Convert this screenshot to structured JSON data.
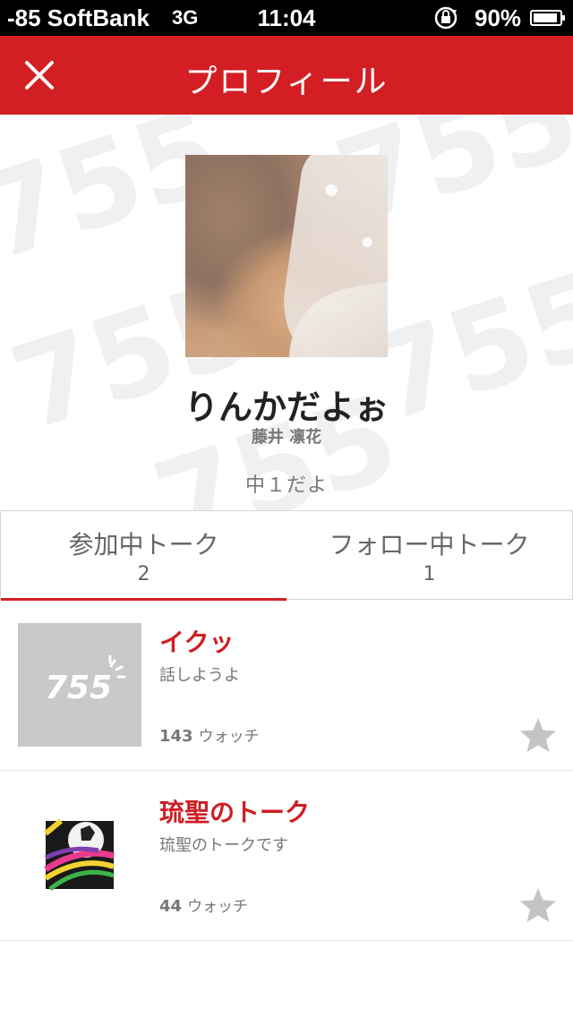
{
  "status_bar": {
    "carrier": "-85 SoftBank",
    "network": "3G",
    "time": "11:04",
    "battery": "90%"
  },
  "nav": {
    "title": "プロフィール",
    "close_icon": "close-icon"
  },
  "profile": {
    "display_name": "りんかだよぉ",
    "real_name": "藤井 凛花",
    "bio": "中１だよ",
    "watermark_text": "755"
  },
  "tabs": [
    {
      "label": "参加中トーク",
      "count": "2",
      "active": true
    },
    {
      "label": "フォロー中トーク",
      "count": "1",
      "active": false
    }
  ],
  "talks": [
    {
      "title": "イクッ",
      "description": "話しようよ",
      "watch_count": "143",
      "watch_label": "ウォッチ",
      "thumb_logo": "755"
    },
    {
      "title": "琉聖のトーク",
      "description": "琉聖のトークです",
      "watch_count": "44",
      "watch_label": "ウォッチ"
    }
  ],
  "colors": {
    "accent": "#d31f23",
    "star": "#c4c4c4"
  }
}
